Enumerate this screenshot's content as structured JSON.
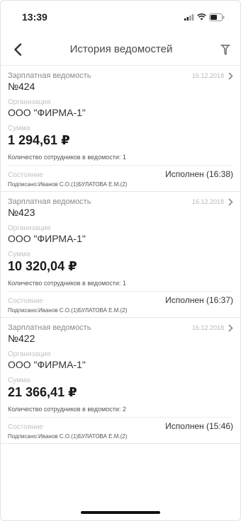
{
  "status_bar": {
    "time": "13:39"
  },
  "nav": {
    "title": "История ведомостей",
    "back_icon": "chevron-left-icon",
    "filter_icon": "filter-icon"
  },
  "labels": {
    "organization": "Организация",
    "sum": "Сумма",
    "state": "Состояние"
  },
  "items": [
    {
      "type": "Зарплатная ведомость",
      "number": "№424",
      "date": "16.12.2018",
      "organization": "ООО \"ФИРМА-1\"",
      "amount": "1 294,61 ₽",
      "employees": "Количество сотрудников в ведомости: 1",
      "state": "Исполнен (16:38)",
      "signed": "Подписано:Иванов С.О.(1)БУЛАТОВА Е.М.(2)"
    },
    {
      "type": "Зарплатная ведомость",
      "number": "№423",
      "date": "16.12.2018",
      "organization": "ООО \"ФИРМА-1\"",
      "amount": "10 320,04 ₽",
      "employees": "Количество сотрудников в ведомости: 1",
      "state": "Исполнен (16:37)",
      "signed": "Подписано:Иванов С.О.(1)БУЛАТОВА Е.М.(2)"
    },
    {
      "type": "Зарплатная ведомость",
      "number": "№422",
      "date": "16.12.2018",
      "organization": "ООО \"ФИРМА-1\"",
      "amount": "21 366,41 ₽",
      "employees": "Количество сотрудников в ведомости: 2",
      "state": "Исполнен (15:46)",
      "signed": "Подписано:Иванов С.О.(1)БУЛАТОВА Е.М.(2)"
    }
  ]
}
